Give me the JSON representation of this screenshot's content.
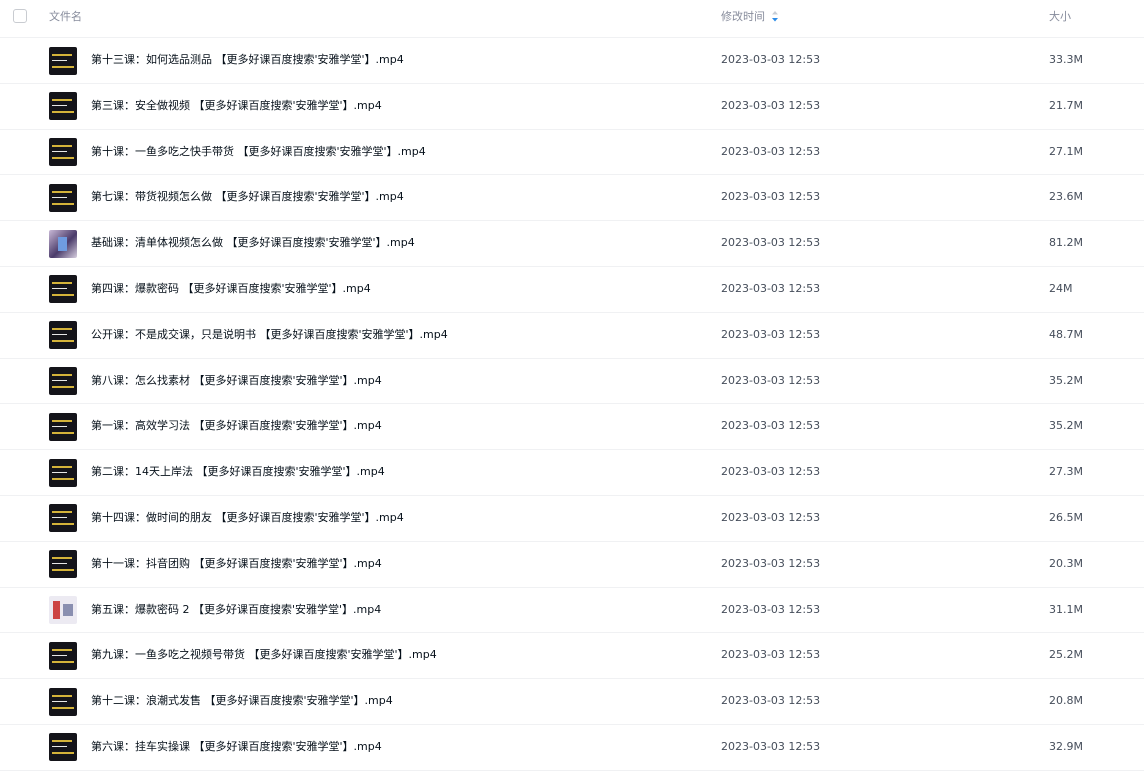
{
  "header": {
    "name_label": "文件名",
    "time_label": "修改时间",
    "size_label": "大小",
    "sort_icon": "sort-descending-icon",
    "sort_color": "#2b8be8"
  },
  "files": [
    {
      "name": "第十三课：如何选品测品 【更多好课百度搜索'安雅学堂'】.mp4",
      "time": "2023-03-03 12:53",
      "size": "33.3M",
      "thumb": "dark"
    },
    {
      "name": "第三课：安全做视频 【更多好课百度搜索'安雅学堂'】.mp4",
      "time": "2023-03-03 12:53",
      "size": "21.7M",
      "thumb": "dark"
    },
    {
      "name": "第十课：一鱼多吃之快手带货 【更多好课百度搜索'安雅学堂'】.mp4",
      "time": "2023-03-03 12:53",
      "size": "27.1M",
      "thumb": "dark"
    },
    {
      "name": "第七课：带货视频怎么做 【更多好课百度搜索'安雅学堂'】.mp4",
      "time": "2023-03-03 12:53",
      "size": "23.6M",
      "thumb": "dark"
    },
    {
      "name": "基础课：清单体视频怎么做 【更多好课百度搜索'安雅学堂'】.mp4",
      "time": "2023-03-03 12:53",
      "size": "81.2M",
      "thumb": "photo"
    },
    {
      "name": "第四课：爆款密码 【更多好课百度搜索'安雅学堂'】.mp4",
      "time": "2023-03-03 12:53",
      "size": "24M",
      "thumb": "dark"
    },
    {
      "name": "公开课：不是成交课，只是说明书 【更多好课百度搜索'安雅学堂'】.mp4",
      "time": "2023-03-03 12:53",
      "size": "48.7M",
      "thumb": "dark"
    },
    {
      "name": "第八课：怎么找素材 【更多好课百度搜索'安雅学堂'】.mp4",
      "time": "2023-03-03 12:53",
      "size": "35.2M",
      "thumb": "dark"
    },
    {
      "name": "第一课：高效学习法 【更多好课百度搜索'安雅学堂'】.mp4",
      "time": "2023-03-03 12:53",
      "size": "35.2M",
      "thumb": "dark"
    },
    {
      "name": "第二课：14天上岸法 【更多好课百度搜索'安雅学堂'】.mp4",
      "time": "2023-03-03 12:53",
      "size": "27.3M",
      "thumb": "dark"
    },
    {
      "name": "第十四课：做时间的朋友 【更多好课百度搜索'安雅学堂'】.mp4",
      "time": "2023-03-03 12:53",
      "size": "26.5M",
      "thumb": "dark"
    },
    {
      "name": "第十一课：抖音团购 【更多好课百度搜索'安雅学堂'】.mp4",
      "time": "2023-03-03 12:53",
      "size": "20.3M",
      "thumb": "dark"
    },
    {
      "name": "第五课：爆款密码 2 【更多好课百度搜索'安雅学堂'】.mp4",
      "time": "2023-03-03 12:53",
      "size": "31.1M",
      "thumb": "light"
    },
    {
      "name": "第九课：一鱼多吃之视频号带货 【更多好课百度搜索'安雅学堂'】.mp4",
      "time": "2023-03-03 12:53",
      "size": "25.2M",
      "thumb": "dark"
    },
    {
      "name": "第十二课：浪潮式发售 【更多好课百度搜索'安雅学堂'】.mp4",
      "time": "2023-03-03 12:53",
      "size": "20.8M",
      "thumb": "dark"
    },
    {
      "name": "第六课：挂车实操课 【更多好课百度搜索'安雅学堂'】.mp4",
      "time": "2023-03-03 12:53",
      "size": "32.9M",
      "thumb": "dark"
    }
  ]
}
